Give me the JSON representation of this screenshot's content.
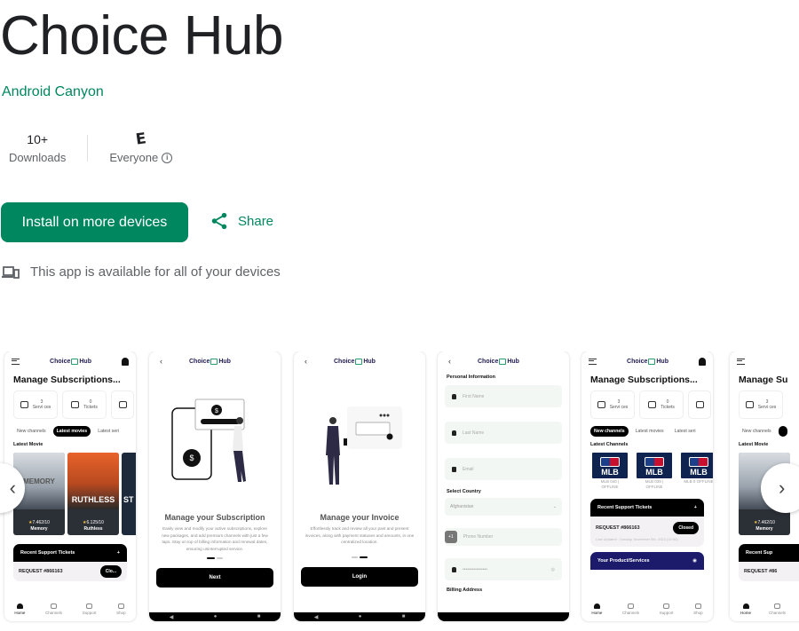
{
  "app": {
    "title": "Choice Hub",
    "developer": "Android Canyon"
  },
  "stats": {
    "downloads_value": "10+",
    "downloads_label": "Downloads",
    "rating_glyph": "E",
    "rating_label": "Everyone",
    "info_glyph": "i"
  },
  "actions": {
    "install_label": "Install on more devices",
    "share_label": "Share"
  },
  "devices_note": "This app is available for all of your devices",
  "colors": {
    "brand_green": "#01875f",
    "navy": "#1b1a6b"
  },
  "screenshots": {
    "logo_left": "Choice",
    "logo_right": "Hub",
    "home": {
      "heading": "Manage Subscriptions...",
      "services_count": "3",
      "services_label": "Servi ces",
      "tickets_count": "0",
      "tickets_label": "Tickets",
      "chips": [
        "New channels",
        "Latest movies",
        "Latest seri"
      ],
      "section": "Latest Movie",
      "movies": [
        {
          "rating": "7.462/10",
          "title": "Memory",
          "poster_text": "MEMORY"
        },
        {
          "rating": "6.125/10",
          "title": "Ruthless",
          "poster_text": "RUTHLESS"
        },
        {
          "rating": "",
          "title": "",
          "poster_text": "ST"
        }
      ],
      "support_title": "Recent Support Tickets",
      "support_plus": "+",
      "request": "REQUEST #866163",
      "request_status_short": "Clo...",
      "nav": [
        "Home",
        "Channels",
        "Support",
        "Shop"
      ]
    },
    "onboarding1": {
      "title": "Manage your Subscription",
      "text": "Easily view and modify your active subscriptions, explore new packages, and add premium channels with just a few taps. Stay on top of billing information and renewal dates, ensuring uninterrupted service.",
      "button": "Next"
    },
    "onboarding2": {
      "title": "Manage your Invoice",
      "text": "Effortlessly track and review all your past and present invoices, along with payment statuses and amounts, in one centralized location.",
      "button": "Login"
    },
    "register": {
      "section": "Personal Information",
      "first_name": "First Name",
      "last_name": "Last Name",
      "email": "Email",
      "country_label": "Select Country",
      "country_value": "Afghanistan",
      "dial_code": "+1",
      "phone": "Phone Number",
      "password_mask": "••••••••••••••••",
      "billing": "Billing Address"
    },
    "channels": {
      "heading": "Manage Subscriptions...",
      "chips": [
        "New channels",
        "Latest movies",
        "Latest seri"
      ],
      "section": "Latest Channels",
      "items": [
        {
          "logo": "MLB",
          "caption": "MLB 040 | OFFLINE"
        },
        {
          "logo": "MLB",
          "caption": "MLB 039 | OFFLINE"
        },
        {
          "logo": "MLB",
          "caption": "MLB 0 OFFLINE"
        }
      ],
      "support_title": "Recent Support Tickets",
      "request": "REQUEST #866163",
      "status": "Closed",
      "last_updated": "Last Updated : Sunday, November 5th, 2023 (10:00)",
      "products": "Your Product/Services"
    },
    "partial": {
      "heading": "Manage Su",
      "logo": "Ch",
      "chip": "New channels",
      "section": "Latest Movie",
      "movie_rating": "7.462/10",
      "movie_title": "Memory",
      "support": "Recent Sup",
      "request": "REQUEST #86"
    }
  },
  "carousel": {
    "prev_glyph": "‹",
    "next_glyph": "›"
  }
}
